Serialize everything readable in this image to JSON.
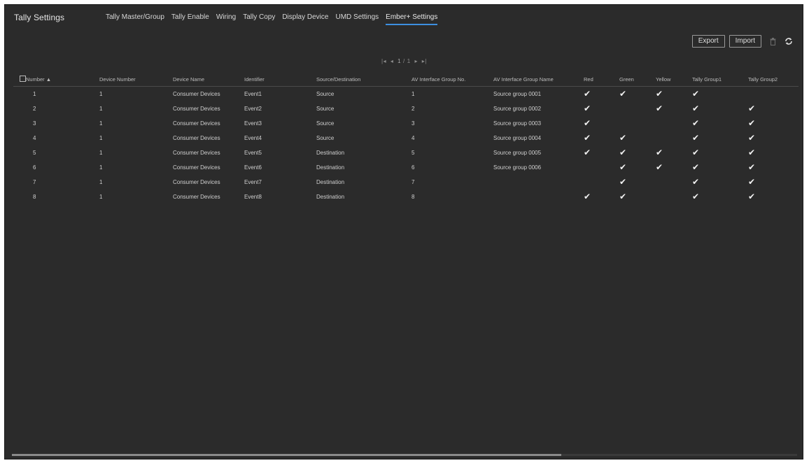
{
  "app": {
    "title": "Tally Settings"
  },
  "tabs": [
    {
      "label": "Tally Master/Group"
    },
    {
      "label": "Tally Enable"
    },
    {
      "label": "Wiring"
    },
    {
      "label": "Tally Copy"
    },
    {
      "label": "Display Device"
    },
    {
      "label": "UMD Settings"
    },
    {
      "label": "Ember+ Settings"
    }
  ],
  "active_tab": "Ember+ Settings",
  "toolbar": {
    "export_label": "Export",
    "import_label": "Import",
    "delete_icon": "trash-icon",
    "refresh_icon": "refresh-icon"
  },
  "pager": {
    "first": "|◂",
    "prev": "◂",
    "page": "1",
    "sep": "/",
    "total": "1",
    "next": "▸",
    "last": "▸|"
  },
  "columns": [
    "Number ▲",
    "Device Number",
    "Device Name",
    "Identifier",
    "Source/Destination",
    "AV Interface Group No.",
    "AV Interface Group Name",
    "Red",
    "Green",
    "Yellow",
    "Tally Group1",
    "Tally Group2"
  ],
  "rows": [
    {
      "number": "1",
      "device_number": "1",
      "device_name": "Consumer Devices",
      "identifier": "Event1",
      "source_destination": "Source",
      "group_no": "1",
      "group_name": "Source group 0001",
      "red": true,
      "green": true,
      "yellow": true,
      "tally1": true,
      "tally2": false
    },
    {
      "number": "2",
      "device_number": "1",
      "device_name": "Consumer Devices",
      "identifier": "Event2",
      "source_destination": "Source",
      "group_no": "2",
      "group_name": "Source group 0002",
      "red": true,
      "green": false,
      "yellow": true,
      "tally1": true,
      "tally2": true
    },
    {
      "number": "3",
      "device_number": "1",
      "device_name": "Consumer Devices",
      "identifier": "Event3",
      "source_destination": "Source",
      "group_no": "3",
      "group_name": "Source group 0003",
      "red": true,
      "green": false,
      "yellow": false,
      "tally1": true,
      "tally2": true
    },
    {
      "number": "4",
      "device_number": "1",
      "device_name": "Consumer Devices",
      "identifier": "Event4",
      "source_destination": "Source",
      "group_no": "4",
      "group_name": "Source group 0004",
      "red": true,
      "green": true,
      "yellow": false,
      "tally1": true,
      "tally2": true
    },
    {
      "number": "5",
      "device_number": "1",
      "device_name": "Consumer Devices",
      "identifier": "Event5",
      "source_destination": "Destination",
      "group_no": "5",
      "group_name": "Source group 0005",
      "red": true,
      "green": true,
      "yellow": true,
      "tally1": true,
      "tally2": true
    },
    {
      "number": "6",
      "device_number": "1",
      "device_name": "Consumer Devices",
      "identifier": "Event6",
      "source_destination": "Destination",
      "group_no": "6",
      "group_name": "Source group 0006",
      "red": false,
      "green": true,
      "yellow": true,
      "tally1": true,
      "tally2": true
    },
    {
      "number": "7",
      "device_number": "1",
      "device_name": "Consumer Devices",
      "identifier": "Event7",
      "source_destination": "Destination",
      "group_no": "7",
      "group_name": "",
      "red": false,
      "green": true,
      "yellow": false,
      "tally1": true,
      "tally2": true
    },
    {
      "number": "8",
      "device_number": "1",
      "device_name": "Consumer Devices",
      "identifier": "Event8",
      "source_destination": "Destination",
      "group_no": "8",
      "group_name": "",
      "red": true,
      "green": true,
      "yellow": false,
      "tally1": true,
      "tally2": true
    }
  ],
  "check_mark": "✔",
  "horizontal_scroll_fraction": 0.7
}
